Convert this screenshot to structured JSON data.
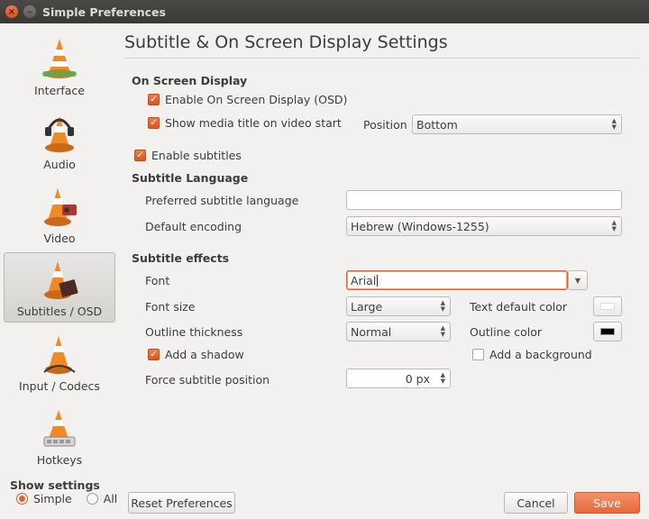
{
  "window": {
    "title": "Simple Preferences"
  },
  "sidebar": {
    "items": [
      {
        "label": "Interface",
        "icon": "interface-cone-icon",
        "active": false
      },
      {
        "label": "Audio",
        "icon": "audio-headphones-cone-icon",
        "active": false
      },
      {
        "label": "Video",
        "icon": "video-cone-icon",
        "active": false
      },
      {
        "label": "Subtitles / OSD",
        "icon": "subtitles-cone-icon",
        "active": true
      },
      {
        "label": "Input / Codecs",
        "icon": "input-codecs-cone-icon",
        "active": false
      },
      {
        "label": "Hotkeys",
        "icon": "hotkeys-cone-icon",
        "active": false
      }
    ],
    "show_settings_label": "Show settings",
    "radio_simple": "Simple",
    "radio_all": "All",
    "selected_mode": "Simple"
  },
  "main": {
    "title": "Subtitle & On Screen Display Settings",
    "osd": {
      "heading": "On Screen Display",
      "enable_osd_label": "Enable On Screen Display (OSD)",
      "enable_osd_checked": true,
      "show_title_label": "Show media title on video start",
      "show_title_checked": true,
      "position_label": "Position",
      "position_value": "Bottom"
    },
    "enable_subtitles_label": "Enable subtitles",
    "enable_subtitles_checked": true,
    "language": {
      "heading": "Subtitle Language",
      "preferred_label": "Preferred subtitle language",
      "preferred_value": "",
      "encoding_label": "Default encoding",
      "encoding_value": "Hebrew (Windows-1255)"
    },
    "effects": {
      "heading": "Subtitle effects",
      "font_label": "Font",
      "font_value": "Arial",
      "font_size_label": "Font size",
      "font_size_value": "Large",
      "text_color_label": "Text default color",
      "text_color": "#ffffff",
      "outline_thickness_label": "Outline thickness",
      "outline_thickness_value": "Normal",
      "outline_color_label": "Outline color",
      "outline_color": "#000000",
      "shadow_label": "Add a shadow",
      "shadow_checked": true,
      "background_label": "Add a background",
      "background_checked": false,
      "force_position_label": "Force subtitle position",
      "force_position_value": "0 px"
    }
  },
  "footer": {
    "reset_label": "Reset Preferences",
    "cancel_label": "Cancel",
    "save_label": "Save"
  },
  "colors": {
    "accent": "#e8683a",
    "window_bg": "#f2f1f0",
    "titlebar": "#3c3b37"
  }
}
